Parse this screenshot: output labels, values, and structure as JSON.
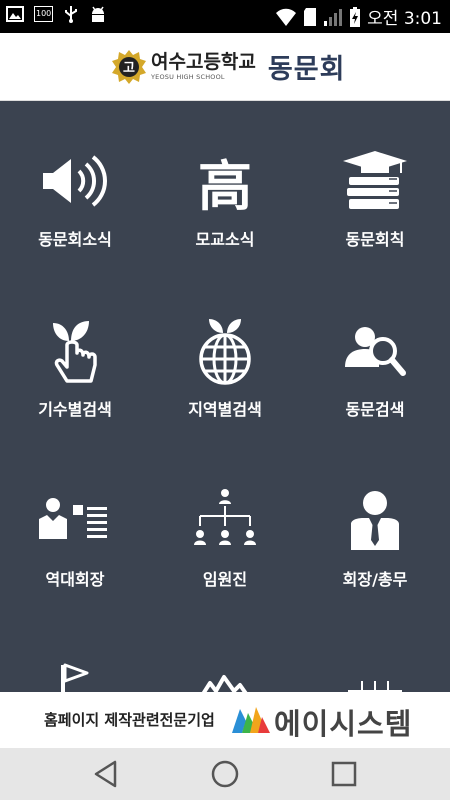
{
  "status_bar": {
    "battery_label": "100",
    "time": "오전 3:01"
  },
  "header": {
    "logo_char": "고",
    "school_name": "여수고등학교",
    "school_sub": "YEOSU HIGH SCHOOL",
    "title": "동문회"
  },
  "menu": [
    {
      "label": "동문회소식",
      "icon": "speaker-icon"
    },
    {
      "label": "모교소식",
      "icon": "school-hanja-icon",
      "glyph": "高"
    },
    {
      "label": "동문회칙",
      "icon": "books-graduation-cap-icon"
    },
    {
      "label": "기수별검색",
      "icon": "sprout-hand-icon"
    },
    {
      "label": "지역별검색",
      "icon": "globe-sprout-icon"
    },
    {
      "label": "동문검색",
      "icon": "person-search-icon"
    },
    {
      "label": "역대회장",
      "icon": "person-list-icon"
    },
    {
      "label": "임원진",
      "icon": "org-chart-icon"
    },
    {
      "label": "회장/총무",
      "icon": "businessman-icon"
    },
    {
      "label": "",
      "icon": "flag-icon"
    },
    {
      "label": "",
      "icon": "mountain-icon"
    },
    {
      "label": "",
      "icon": "abacus-icon"
    }
  ],
  "footer": {
    "text": "홈페이지 제작관련전문기업",
    "brand": "에이시스템"
  },
  "colors": {
    "background": "#3b4350",
    "header_title": "#2d3c5a",
    "logo_gold": "#d4a82a"
  }
}
